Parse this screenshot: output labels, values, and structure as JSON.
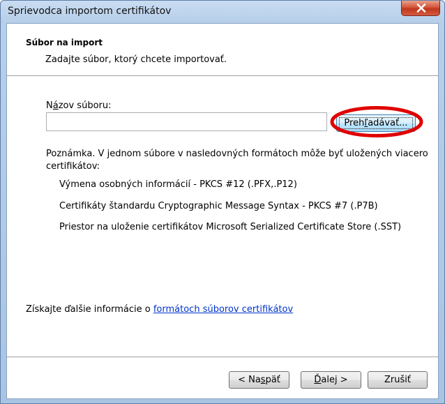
{
  "window": {
    "title": "Sprievodca importom certifikátov",
    "close_icon": "close-icon"
  },
  "header": {
    "title": "Súbor na import",
    "description": "Zadajte súbor, ktorý chcete importovať."
  },
  "file": {
    "label_prefix": "N",
    "label_accel": "á",
    "label_suffix": "zov súboru:",
    "value": "",
    "browse_prefix": "Preh",
    "browse_accel": "ľ",
    "browse_suffix": "adávať..."
  },
  "note": {
    "text_line1": "Poznámka. V jednom súbore v nasledovných formátoch môže byť uložených viacero",
    "text_line2": "certifikátov:",
    "formats": [
      "Výmena osobných informácií - PKCS #12 (.PFX,.P12)",
      "Certifikáty štandardu Cryptographic Message Syntax - PKCS #7 (.P7B)",
      "Priestor na uloženie certifikátov Microsoft Serialized Certificate Store (.SST)"
    ]
  },
  "info": {
    "text": "Získajte ďalšie informácie o ",
    "link": "formátoch súborov certifikátov"
  },
  "buttons": {
    "back_prefix": "< Na",
    "back_accel": "s",
    "back_suffix": "päť",
    "next_accel": "Ď",
    "next_suffix": "alej >",
    "cancel": "Zrušiť"
  },
  "annotation": {
    "color": "#e00000"
  }
}
